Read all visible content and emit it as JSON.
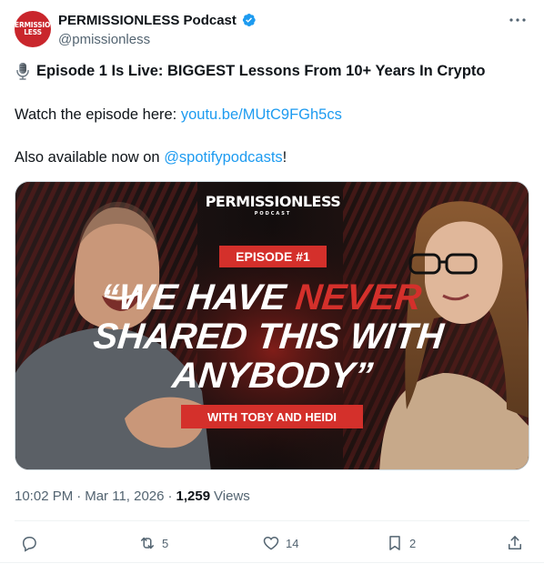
{
  "author": {
    "display_name": "PERMISSIONLESS Podcast",
    "handle": "@pmissionless",
    "avatar_text_top": "PERMISSION",
    "avatar_text_bottom": "LESS",
    "avatar_color": "#c9262c",
    "verified": true
  },
  "tweet": {
    "title": "Episode 1 Is Live: BIGGEST Lessons From 10+ Years In Crypto",
    "title_icon": "microphone-icon",
    "watch_prefix": "Watch the episode here: ",
    "watch_link": "youtu.be/MUtC9FGh5cs",
    "also_prefix": "Also available now on ",
    "also_mention": "@spotifypodcasts",
    "also_suffix": "!"
  },
  "thumbnail": {
    "logo": "PERMISSIONLESS",
    "logo_sub": "PODCAST",
    "episode": "EPISODE #1",
    "quote_line1_a": "“WE HAVE ",
    "quote_line1_b": "NEVER",
    "quote_line2": "SHARED THIS WITH",
    "quote_line3": "ANYBODY”",
    "guests": "WITH TOBY AND HEIDI",
    "accent": "#d4302b"
  },
  "meta": {
    "time": "10:02 PM",
    "sep": "·",
    "date": "Mar 11, 2026",
    "sep2": "·",
    "views_count": "1,259",
    "views_label": "Views"
  },
  "actions": {
    "reply_count": "",
    "retweet_count": "5",
    "like_count": "14",
    "bookmark_count": "2"
  },
  "colors": {
    "link": "#1d9bf0",
    "muted": "#536471",
    "text": "#0f1419"
  }
}
